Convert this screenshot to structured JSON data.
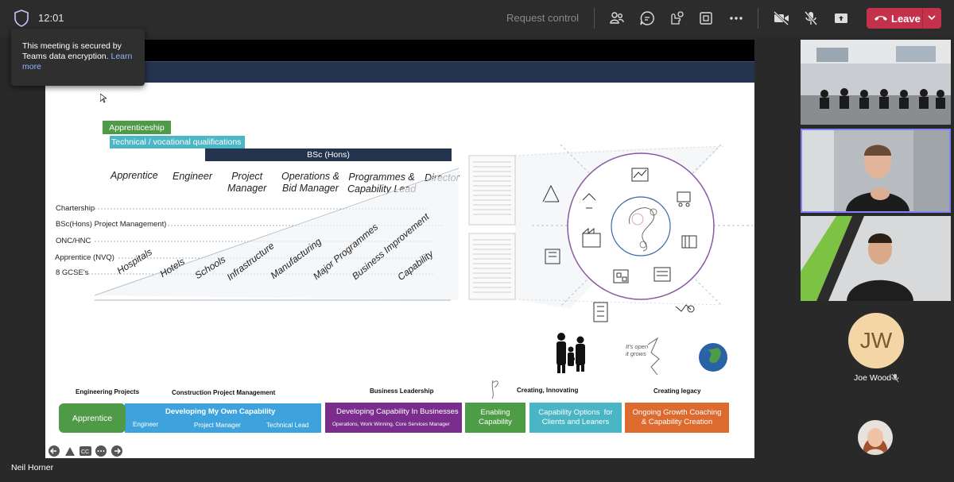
{
  "meeting": {
    "time": "12:01",
    "request_control": "Request control",
    "leave_label": "Leave",
    "icons": [
      "people-icon",
      "chat-icon",
      "reactions-icon",
      "rooms-icon",
      "more-icon",
      "camera-off-icon",
      "mic-off-icon",
      "share-icon"
    ]
  },
  "tooltip": {
    "text": "This meeting is secured by Teams data encryption.",
    "link": "Learn more"
  },
  "presenter_name": "Neil Horner",
  "participants": [
    {
      "name": "Joe Wood",
      "initials": "JW",
      "muted": true
    }
  ],
  "slide": {
    "bars": {
      "apprenticeship": "Apprenticeship",
      "technical": "Technical / vocational qualifications",
      "bsc": "BSc (Hons)"
    },
    "roles": [
      "Apprentice",
      "Engineer",
      "Project\nManager",
      "Operations &\nBid Manager",
      "Programmes &\nCapability Lead",
      "Director"
    ],
    "qualifications": [
      "Chartership",
      "BSc(Hons) Project Management)",
      "ONC/HNC",
      "Apprentice (NVQ)",
      "8 GCSE's"
    ],
    "sectors": [
      "Hospitals",
      "Hotels",
      "Schools",
      "Infrastructure",
      "Manufacturing",
      "Major Programmes",
      "Business Improvement",
      "Capability"
    ],
    "categories": {
      "engineering_projects": "Engineering Projects",
      "construction_pm": "Construction Project Management",
      "business_leadership": "Business Leadership",
      "creating_innovating": "Creating, Innovating",
      "creating_legacy": "Creating legacy"
    },
    "bottom": {
      "apprentice": "Apprentice",
      "developing_own": "Developing My Own Capability",
      "engineer": "Engineer",
      "project_manager": "Project Manager",
      "technical_lead": "Technical Lead",
      "developing_business": "Developing Capability In Businesses",
      "developing_business_sub": "Operations, Work Winning, Core Services Manager",
      "enabling": "Enabling\nCapability",
      "options": "Capability Options  for\nClients and Leaners",
      "ongoing": "Ongoing Growth Coaching\n& Capability Creation"
    },
    "tree_text": "It's open it grows"
  },
  "colors": {
    "leave": "#c4314b",
    "green": "#4f9a46",
    "teal": "#4bb6c5",
    "navy": "#24344f",
    "blue": "#3ea3dc",
    "purple": "#7b2d8e",
    "darkgreen": "#4d9d47",
    "cyan": "#4ab5c4",
    "orange": "#dd6a2f"
  }
}
